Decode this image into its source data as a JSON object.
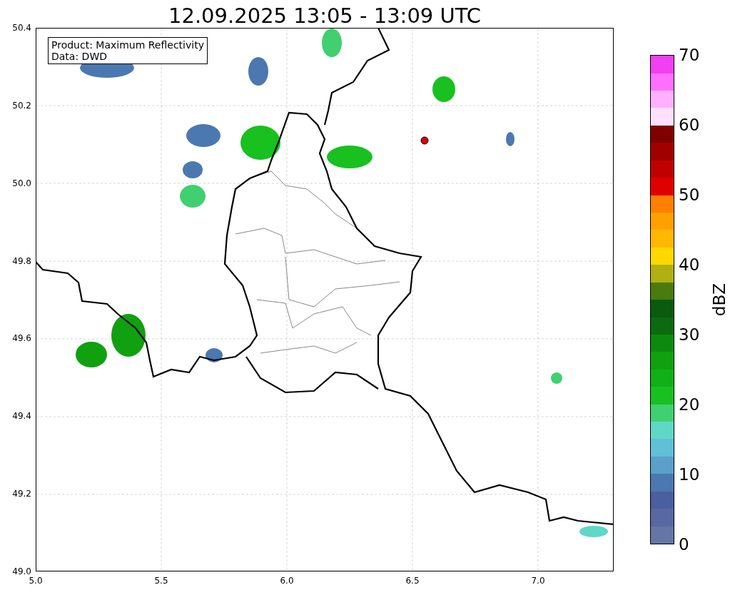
{
  "title": "12.09.2025 13:05 - 13:09 UTC",
  "legend": [
    "Product: Maximum Reflectivity",
    "Data: DWD"
  ],
  "axes": {
    "xticks": [
      "5.0",
      "5.5",
      "6.0",
      "6.5",
      "7.0"
    ],
    "yticks": [
      "50.4",
      "50.2",
      "50.0",
      "49.8",
      "49.6",
      "49.4",
      "49.2",
      "49.0"
    ]
  },
  "colorbar": {
    "label": "dBZ",
    "ticks": [
      "70",
      "60",
      "50",
      "40",
      "30",
      "20",
      "10",
      "0"
    ]
  }
}
